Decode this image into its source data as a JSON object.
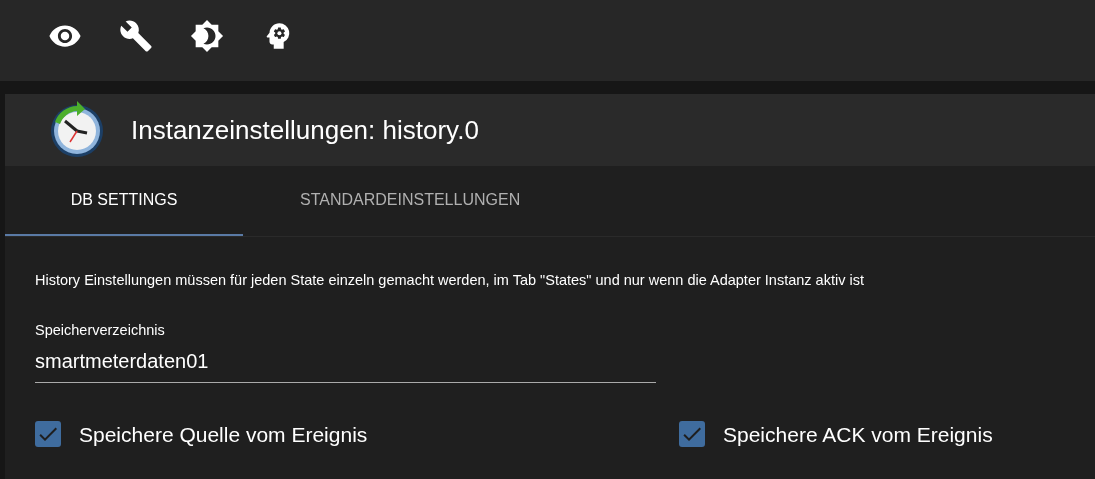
{
  "toolbar": {
    "buttons": [
      {
        "kind": "eye"
      },
      {
        "kind": "wrench"
      },
      {
        "kind": "theme"
      },
      {
        "kind": "head"
      }
    ]
  },
  "dialog": {
    "title": "Instanzeinstellungen: history.0",
    "tabs": [
      {
        "label": "DB SETTINGS",
        "selected": true
      },
      {
        "label": "STANDARDEINSTELLUNGEN",
        "selected": false
      }
    ],
    "info": "History Einstellungen müssen für jeden State einzeln gemacht werden, im Tab \"States\" und nur wenn die Adapter Instanz aktiv ist",
    "storage_dir": {
      "label": "Speicherverzeichnis",
      "value": "smartmeterdaten01"
    },
    "checkboxes": [
      {
        "label": "Speichere Quelle vom Ereignis",
        "checked": true
      },
      {
        "label": "Speichere ACK vom Ereignis",
        "checked": true
      }
    ]
  }
}
